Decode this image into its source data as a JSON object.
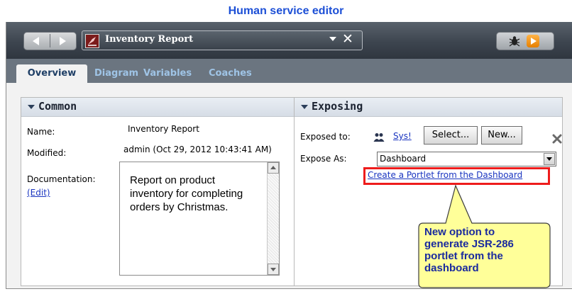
{
  "caption": "Human service editor",
  "toolbar": {
    "process_title": "Inventory Report"
  },
  "tabs": [
    {
      "label": "Overview"
    },
    {
      "label": "Diagram"
    },
    {
      "label": "Variables"
    },
    {
      "label": "Coaches"
    }
  ],
  "common": {
    "title": "Common",
    "name_label": "Name:",
    "name_value": "Inventory Report",
    "modified_label": "Modified:",
    "modified_value": "admin (Oct 29, 2012 10:43:41 AM)",
    "documentation_label": "Documentation:",
    "edit_link": "(Edit)",
    "documentation_text": "Report on product inventory for completing orders by Christmas."
  },
  "exposing": {
    "title": "Exposing",
    "exposed_to_label": "Exposed to:",
    "sys_link": "Sys!",
    "select_button": "Select...",
    "new_button": "New...",
    "expose_as_label": "Expose As:",
    "expose_as_value": "Dashboard",
    "portlet_link": "Create a Portlet from the Dashboard"
  },
  "callout": {
    "text": "New option to generate JSR-286 portlet from the dashboard",
    "fill": "#ffff99",
    "text_color": "#1a2a9e"
  },
  "highlight_color": "#ee1c1c"
}
